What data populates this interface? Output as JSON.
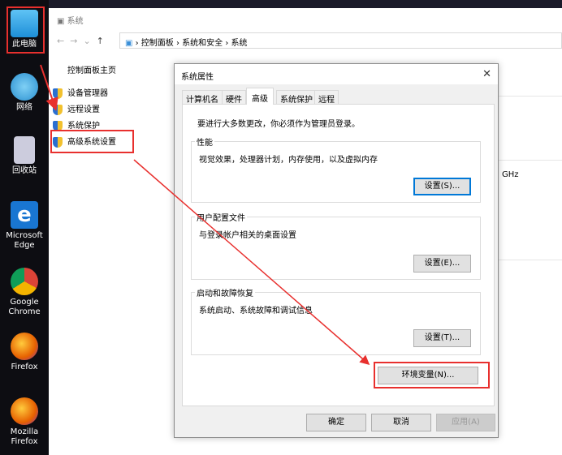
{
  "desktop": {
    "icons": [
      "此电脑",
      "网络",
      "回收站",
      "Microsoft Edge",
      "Google Chrome",
      "Firefox",
      "Mozilla Firefox"
    ]
  },
  "explorer": {
    "title": "系统",
    "breadcrumb": [
      "控制面板",
      "系统和安全",
      "系统"
    ],
    "home": "控制面板主页",
    "links": [
      "设备管理器",
      "远程设置",
      "系统保护",
      "高级系统设置"
    ],
    "cpu_fragment": "GHz"
  },
  "dialog": {
    "title": "系统属性",
    "tabs": [
      "计算机名",
      "硬件",
      "高级",
      "系统保护",
      "远程"
    ],
    "active_tab": "高级",
    "note": "要进行大多数更改，你必须作为管理员登录。",
    "groups": [
      {
        "label": "性能",
        "desc": "视觉效果，处理器计划，内存使用，以及虚拟内存",
        "button": "设置(S)..."
      },
      {
        "label": "用户配置文件",
        "desc": "与登录帐户相关的桌面设置",
        "button": "设置(E)..."
      },
      {
        "label": "启动和故障恢复",
        "desc": "系统启动、系统故障和调试信息",
        "button": "设置(T)..."
      }
    ],
    "env_button": "环境变量(N)...",
    "ok": "确定",
    "cancel": "取消",
    "apply": "应用(A)"
  },
  "colors": {
    "highlight": "#e8302e",
    "accent": "#0078d7"
  }
}
